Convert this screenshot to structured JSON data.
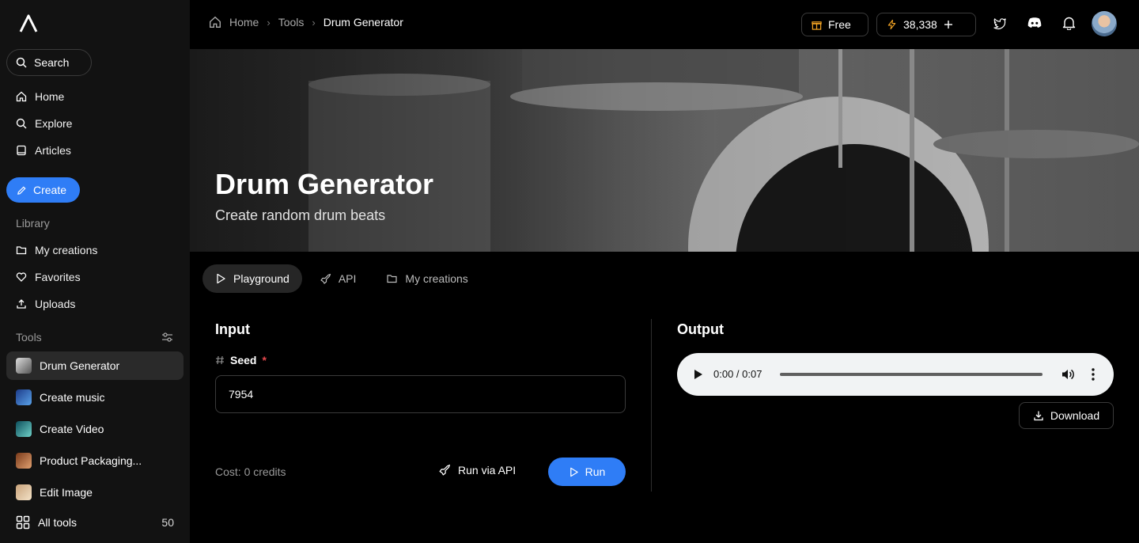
{
  "sidebar": {
    "search_label": "Search",
    "nav": [
      {
        "label": "Home",
        "icon": "home-icon"
      },
      {
        "label": "Explore",
        "icon": "search-icon"
      },
      {
        "label": "Articles",
        "icon": "book-icon"
      }
    ],
    "create_label": "Create",
    "library_label": "Library",
    "library": [
      {
        "label": "My creations",
        "icon": "folder-icon"
      },
      {
        "label": "Favorites",
        "icon": "heart-icon"
      },
      {
        "label": "Uploads",
        "icon": "upload-icon"
      }
    ],
    "tools_label": "Tools",
    "tools": [
      {
        "label": "Drum Generator",
        "active": true
      },
      {
        "label": "Create music",
        "active": false
      },
      {
        "label": "Create Video",
        "active": false
      },
      {
        "label": "Product Packaging...",
        "active": false
      },
      {
        "label": "Edit Image",
        "active": false
      }
    ],
    "all_tools_label": "All tools",
    "all_tools_count": "50"
  },
  "header": {
    "breadcrumbs": [
      "Home",
      "Tools",
      "Drum Generator"
    ],
    "plan_label": "Free",
    "credits": "38,338"
  },
  "hero": {
    "title": "Drum Generator",
    "subtitle": "Create random drum beats"
  },
  "tabs": [
    {
      "label": "Playground",
      "icon": "play-icon",
      "active": true
    },
    {
      "label": "API",
      "icon": "rocket-icon",
      "active": false
    },
    {
      "label": "My creations",
      "icon": "folder-icon",
      "active": false
    }
  ],
  "input": {
    "title": "Input",
    "seed_label": "Seed",
    "required_mark": "*",
    "seed_value": "7954",
    "cost_text": "Cost: 0 credits",
    "run_api_label": "Run via API",
    "run_label": "Run"
  },
  "output": {
    "title": "Output",
    "time": "0:00 / 0:07",
    "progress": 0,
    "download_label": "Download"
  },
  "colors": {
    "accent": "#2f7df6",
    "sidebar_bg": "#121212",
    "required": "#e5484d"
  }
}
